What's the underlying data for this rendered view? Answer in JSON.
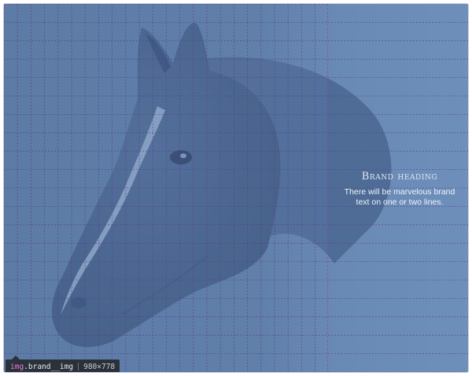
{
  "brand": {
    "heading": "Brand heading",
    "text": "There will be marvelous brand text on one or two lines."
  },
  "inspector_tooltip": {
    "tag": "img",
    "class_name": ".brand__img",
    "dimensions": "980×778"
  },
  "colors": {
    "overlay_blue": "#5f7fa8",
    "grid_line": "#5a3c8c",
    "tooltip_bg": "#2b3138",
    "tooltip_tag": "#ee78e6"
  },
  "icons": {
    "image": "horse-photo"
  }
}
